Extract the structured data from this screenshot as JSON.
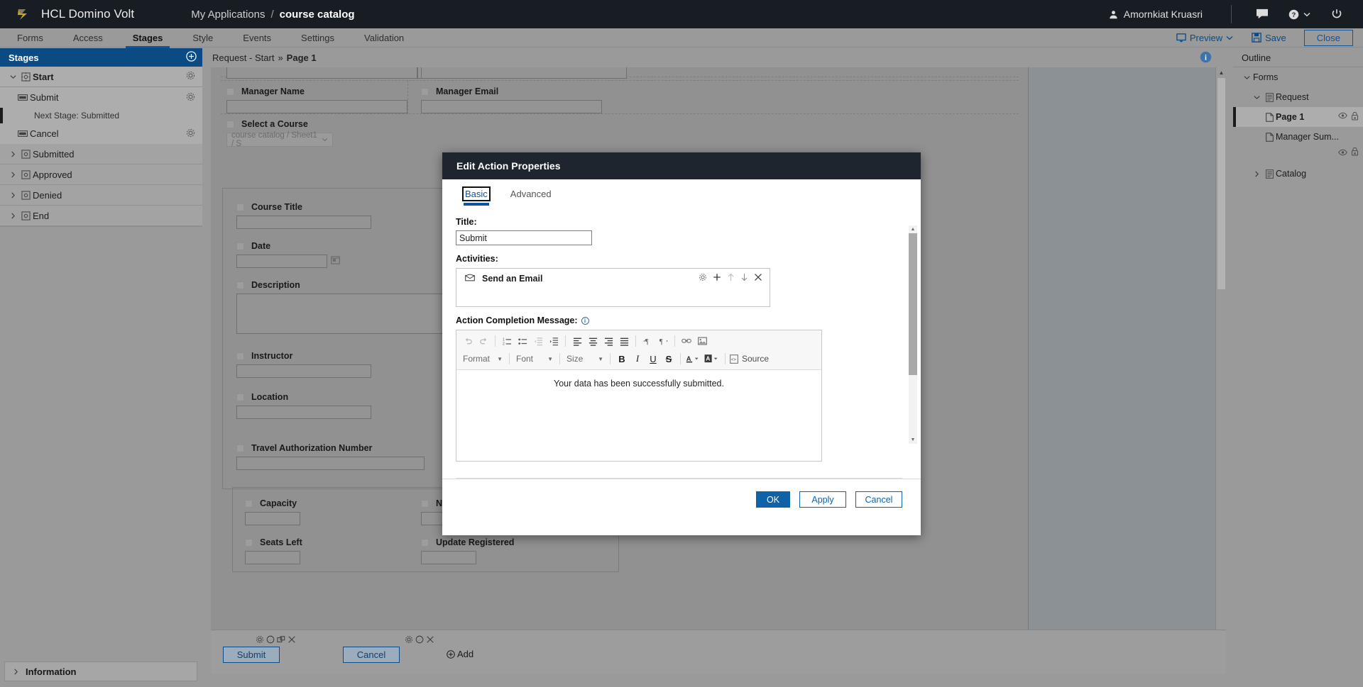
{
  "app": {
    "brand": "HCL Domino Volt",
    "breadcrumb": {
      "root": "My Applications",
      "separator": "/",
      "current": "course catalog"
    },
    "user": "Amornkiat Kruasri",
    "icons": {
      "person": "person-icon",
      "chat": "chat-icon",
      "help": "help-icon",
      "power": "power-icon"
    }
  },
  "nav": {
    "tabs": [
      {
        "label": "Forms",
        "active": false
      },
      {
        "label": "Access",
        "active": false
      },
      {
        "label": "Stages",
        "active": true
      },
      {
        "label": "Style",
        "active": false
      },
      {
        "label": "Events",
        "active": false
      },
      {
        "label": "Settings",
        "active": false
      },
      {
        "label": "Validation",
        "active": false
      }
    ],
    "preview": "Preview",
    "save": "Save",
    "close": "Close"
  },
  "stages_panel": {
    "title": "Stages",
    "add_tooltip": "Add Stage",
    "items": [
      {
        "label": "Start",
        "expanded": true,
        "selected": true
      },
      {
        "label": "Submit",
        "kind": "action",
        "sub": "Next Stage: Submitted"
      },
      {
        "label": "Cancel",
        "kind": "action"
      },
      {
        "label": "Submitted",
        "expanded": false
      },
      {
        "label": "Approved",
        "expanded": false
      },
      {
        "label": "Denied",
        "expanded": false
      },
      {
        "label": "End",
        "expanded": false
      }
    ],
    "information": "Information"
  },
  "canvas": {
    "breadcrumb_prefix": "Request - Start",
    "breadcrumb_sep": "»",
    "breadcrumb_page": "Page 1",
    "fields": [
      {
        "label": "Manager Name",
        "type": "text"
      },
      {
        "label": "Manager Email",
        "type": "text"
      },
      {
        "label": "Select a Course",
        "type": "select",
        "value": "course catalog / Sheet1 / S"
      },
      {
        "label": "Course Title",
        "type": "text"
      },
      {
        "label": "Date",
        "type": "date"
      },
      {
        "label": "Description",
        "type": "textarea"
      },
      {
        "label": "Instructor",
        "type": "text"
      },
      {
        "label": "Location",
        "type": "text"
      },
      {
        "label": "Travel Authorization Number",
        "type": "text"
      },
      {
        "label": "Capacity",
        "type": "text"
      },
      {
        "label": "Number Registered",
        "type": "text"
      },
      {
        "label": "Seats Left",
        "type": "text"
      },
      {
        "label": "Update Registered",
        "type": "text"
      }
    ],
    "buttons": {
      "submit": "Submit",
      "cancel": "Cancel",
      "add": "Add"
    }
  },
  "outline": {
    "title": "Outline",
    "items": [
      {
        "label": "Forms",
        "level": 0,
        "expanded": true,
        "icon": "none"
      },
      {
        "label": "Request",
        "level": 1,
        "expanded": true,
        "icon": "form-icon"
      },
      {
        "label": "Page 1",
        "level": 2,
        "selected": true,
        "icon": "page-icon",
        "actions": [
          "eye-icon",
          "lock-icon"
        ]
      },
      {
        "label": "Manager Sum...",
        "level": 2,
        "icon": "page-icon",
        "actions": [
          "eye-icon",
          "lock-icon"
        ]
      },
      {
        "label": "Catalog",
        "level": 1,
        "expanded": false,
        "icon": "form-icon"
      }
    ]
  },
  "dialog": {
    "title": "Edit Action Properties",
    "tabs": [
      {
        "label": "Basic",
        "active": true
      },
      {
        "label": "Advanced",
        "active": false
      }
    ],
    "title_label": "Title:",
    "title_value": "Submit",
    "activities_label": "Activities:",
    "activities": [
      {
        "label": "Send an Email",
        "icon": "email-icon",
        "actions": [
          "gear-icon",
          "plus-icon",
          "arrow-up-icon",
          "arrow-down-icon",
          "close-icon"
        ]
      }
    ],
    "message_label": "Action Completion Message:",
    "message_info_icon": "info-icon",
    "editor": {
      "row1": [
        "undo-icon",
        "redo-icon",
        "numbered-list-icon",
        "bulleted-list-icon",
        "outdent-icon",
        "indent-icon",
        "align-left-icon",
        "align-center-icon",
        "align-right-icon",
        "justify-icon",
        "ltr-icon",
        "rtl-icon",
        "link-icon",
        "image-icon"
      ],
      "format_label": "Format",
      "font_label": "Font",
      "size_label": "Size",
      "bold": "B",
      "italic": "I",
      "underline": "U",
      "strike": "S",
      "text_color_icon": "text-color-icon",
      "bg_color_icon": "background-color-icon",
      "source_label": "Source"
    },
    "message_body": "Your data has been successfully submitted.",
    "buttons": {
      "ok": "OK",
      "apply": "Apply",
      "cancel": "Cancel"
    }
  },
  "colors": {
    "topbar": "#181c23",
    "accent": "#10529c",
    "panel_header": "#0b4a82",
    "primary_button": "#0f62a8",
    "chrome_gray": "#9a9a9a"
  }
}
